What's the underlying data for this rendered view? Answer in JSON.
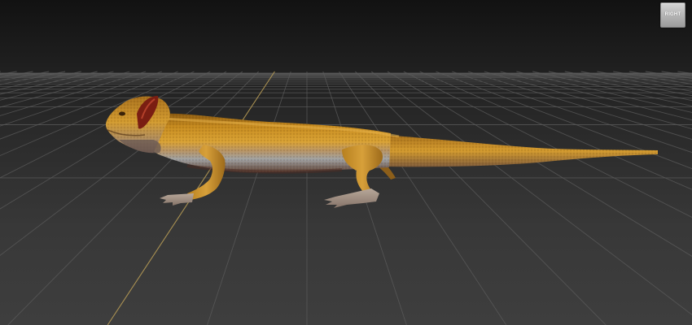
{
  "viewport": {
    "view_label": "RIGHT"
  },
  "scene": {
    "model": "lizard",
    "grid_visible": true,
    "colors": {
      "grid_line": "#5c5c5c",
      "axis_line": "#b59a55",
      "background_top": "#121212",
      "background_bottom": "#3e3e3e",
      "model_base": "#c9901f"
    }
  }
}
